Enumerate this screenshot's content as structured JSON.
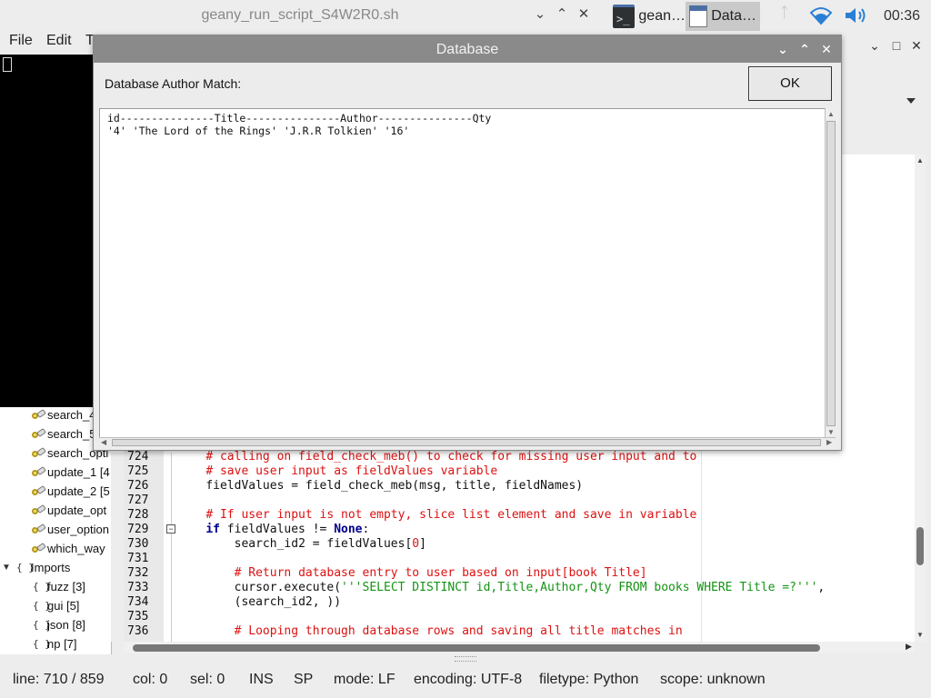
{
  "terminal_window": {
    "title": "geany_run_script_S4W2R0.sh"
  },
  "taskbar": {
    "tasks": [
      {
        "label": "gean…",
        "icon": "terminal-icon",
        "active": false
      },
      {
        "label": "Data…",
        "icon": "window-icon",
        "active": true
      }
    ],
    "clock": "00:36"
  },
  "menubar": {
    "items": [
      "File",
      "Edit",
      "T"
    ]
  },
  "symbols": {
    "functions": [
      "search_4",
      "search_5",
      "search_opti",
      "update_1 [4",
      "update_2 [5",
      "update_opt",
      "user_option",
      "which_way"
    ],
    "imports_label": "Imports",
    "imports": [
      "fuzz [3]",
      "gui [5]",
      "json [8]",
      "np [7]"
    ]
  },
  "editor": {
    "lines": [
      {
        "num": "724",
        "indent": "    ",
        "parts": [
          {
            "t": "# calling on field_check_meb() to check for missing user input and to",
            "c": "cm"
          }
        ]
      },
      {
        "num": "725",
        "indent": "    ",
        "parts": [
          {
            "t": "# save user input as fieldValues variable",
            "c": "cm"
          }
        ]
      },
      {
        "num": "726",
        "indent": "    ",
        "parts": [
          {
            "t": "fieldValues = field_check_meb(msg, title, fieldNames)",
            "c": ""
          }
        ]
      },
      {
        "num": "727",
        "indent": "",
        "parts": []
      },
      {
        "num": "728",
        "indent": "    ",
        "parts": [
          {
            "t": "# If user input is not empty, slice list element and save in variable",
            "c": "cm"
          }
        ]
      },
      {
        "num": "729",
        "indent": "    ",
        "parts": [
          {
            "t": "if",
            "c": "kw"
          },
          {
            "t": " fieldValues != ",
            "c": ""
          },
          {
            "t": "None",
            "c": "kw"
          },
          {
            "t": ":",
            "c": ""
          }
        ]
      },
      {
        "num": "730",
        "indent": "        ",
        "parts": [
          {
            "t": "search_id2 = fieldValues[",
            "c": ""
          },
          {
            "t": "0",
            "c": "num"
          },
          {
            "t": "]",
            "c": ""
          }
        ]
      },
      {
        "num": "731",
        "indent": "",
        "parts": []
      },
      {
        "num": "732",
        "indent": "        ",
        "parts": [
          {
            "t": "# Return database entry to user based on input[book Title]",
            "c": "cm"
          }
        ]
      },
      {
        "num": "733",
        "indent": "        ",
        "parts": [
          {
            "t": "cursor.execute(",
            "c": ""
          },
          {
            "t": "'''SELECT DISTINCT id,Title,Author,Qty FROM books WHERE Title =?'''",
            "c": "str"
          },
          {
            "t": ",",
            "c": ""
          }
        ]
      },
      {
        "num": "734",
        "indent": "        ",
        "parts": [
          {
            "t": "(search_id2, ))",
            "c": ""
          }
        ]
      },
      {
        "num": "735",
        "indent": "",
        "parts": []
      },
      {
        "num": "736",
        "indent": "        ",
        "parts": [
          {
            "t": "# Looping through database rows and saving all title matches in",
            "c": "cm"
          }
        ]
      }
    ]
  },
  "statusbar": {
    "line": "line: 710 / 859",
    "col": "col: 0",
    "sel": "sel: 0",
    "ins": "INS",
    "sp": "SP",
    "mode": "mode: LF",
    "encoding": "encoding: UTF-8",
    "filetype": "filetype: Python",
    "scope": "scope: unknown"
  },
  "dialog": {
    "title": "Database",
    "label": "Database Author Match:",
    "ok_label": "OK",
    "lines": [
      "id---------------Title---------------Author---------------Qty",
      "'4' 'The Lord of the Rings' 'J.R.R Tolkien' '16'"
    ]
  }
}
